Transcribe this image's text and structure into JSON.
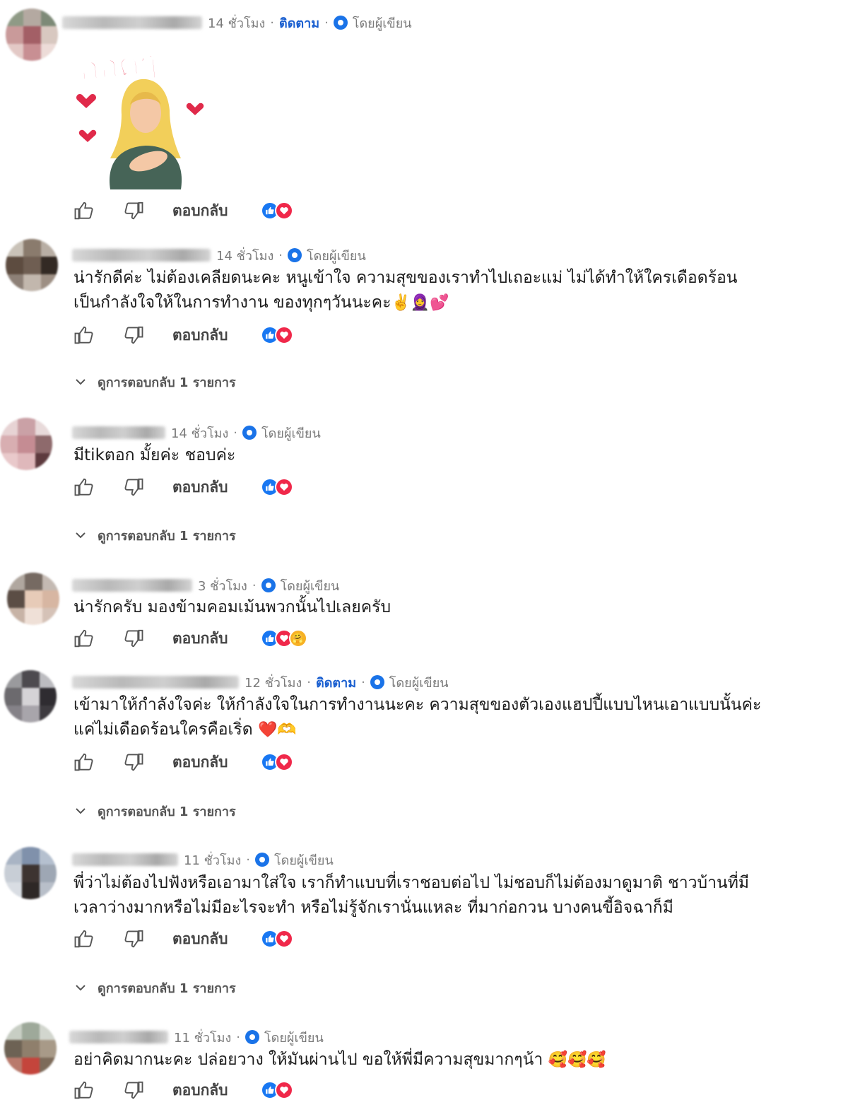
{
  "labels": {
    "reply": "ตอบกลับ",
    "follow": "ติดตาม",
    "by_author": "โดยผู้เขียน",
    "view_replies": "ดูการตอบกลับ 1 รายการ",
    "dot": "·"
  },
  "comments": [
    {
      "time": "14 ชั่วโมง",
      "following": true,
      "sticker_text": "กอดๆ",
      "text": "",
      "reactions": [
        "like",
        "love"
      ],
      "has_replies": false
    },
    {
      "time": "14 ชั่วโมง",
      "following": false,
      "text": "น่ารักดีค่ะ ไม่ต้องเคลียดนะคะ หนูเข้าใจ ความสุขของเราทำไปเถอะแม่ ไม่ได้ทำให้ใครเดือดร้อน\nเป็นกำลังใจให้ในการทำงาน ของทุกๆวันนะคะ",
      "text_emoji": "✌️🧕💕",
      "reactions": [
        "like",
        "love"
      ],
      "has_replies": true
    },
    {
      "time": "14 ชั่วโมง",
      "following": false,
      "text": "มีtikตอก มั้ยค่ะ ชอบค่ะ",
      "text_emoji": "",
      "reactions": [
        "like",
        "love"
      ],
      "has_replies": true
    },
    {
      "time": "3 ชั่วโมง",
      "following": false,
      "text": "น่ารักครับ มองข้ามคอมเม้นพวกนั้นไปเลยครับ",
      "text_emoji": "",
      "reactions": [
        "like",
        "love",
        "care"
      ],
      "has_replies": false
    },
    {
      "time": "12 ชั่วโมง",
      "following": true,
      "text": "เข้ามาให้กำลังใจค่ะ ให้กำลังใจในการทำงานนะคะ ความสุขของตัวเองแฮปปี้แบบไหนเอาแบบนั้นค่ะ\nแค่ไม่เดือดร้อนใครคือเริ่ด",
      "text_emoji": "❤️🫶",
      "reactions": [
        "like",
        "love"
      ],
      "has_replies": true
    },
    {
      "time": "11 ชั่วโมง",
      "following": false,
      "text": "พี่ว่าไม่ต้องไปฟังหรือเอามาใส่ใจ เราก็ทำแบบที่เราชอบต่อไป ไม่ชอบก็ไม่ต้องมาดูมาติ ชาวบ้านที่มี\nเวลาว่างมากหรือไม่มีอะไรจะทำ หรือไม่รู้จักเรานั่นแหละ ที่มาก่อกวน บางคนขี้อิจฉาก็มี",
      "text_emoji": "",
      "reactions": [
        "like",
        "love"
      ],
      "has_replies": true
    },
    {
      "time": "11 ชั่วโมง",
      "following": false,
      "text": "อย่าคิดมากนะคะ ปล่อยวาง ให้มันผ่านไป ขอให้พี่มีความสุขมากๆน้า",
      "text_emoji": "🥰🥰🥰",
      "reactions": [
        "like",
        "love"
      ],
      "has_replies": false
    }
  ],
  "colors": {
    "follow_blue": "#1a5fd0",
    "author_badge": "#1a73e8",
    "like_blue": "#1877f2",
    "love_red": "#f0284a"
  }
}
